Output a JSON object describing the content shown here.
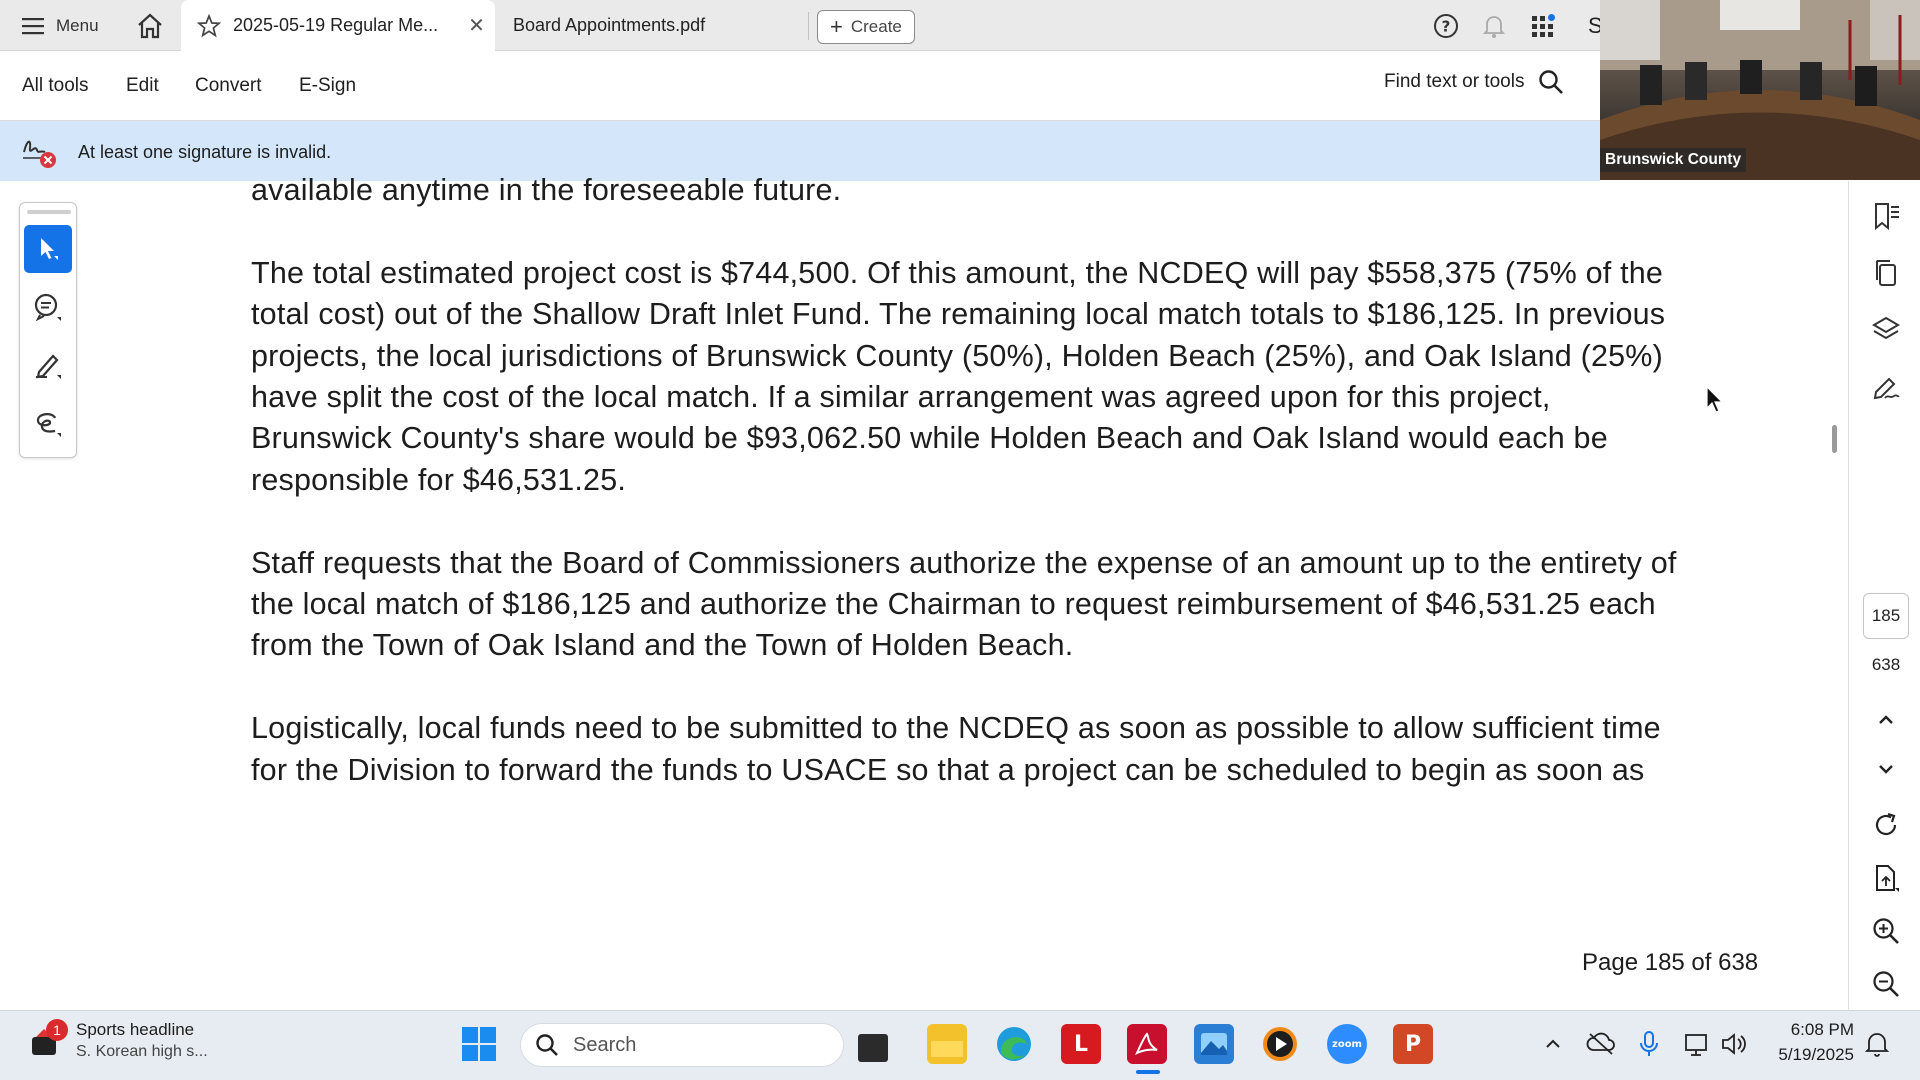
{
  "tabbar": {
    "menu_label": "Menu",
    "tabs": [
      {
        "label": "2025-05-19 Regular Me...",
        "active": true
      },
      {
        "label": "Board Appointments.pdf",
        "active": false
      }
    ],
    "create_label": "Create",
    "profile_initial": "S"
  },
  "toolbar": {
    "menus": [
      "All tools",
      "Edit",
      "Convert",
      "E-Sign"
    ],
    "find_label": "Find text or tools"
  },
  "banner": {
    "message": "At least one signature is invalid."
  },
  "webcam": {
    "caption": "Brunswick County"
  },
  "document": {
    "paragraphs": [
      "available anytime in the foreseeable future.",
      "The total estimated project cost is $744,500. Of this amount, the NCDEQ will pay $558,375 (75% of the total cost) out of the Shallow Draft Inlet Fund. The remaining local match totals to $186,125. In previous projects, the local jurisdictions of Brunswick County (50%), Holden Beach (25%), and Oak Island (25%) have split the cost of the local match. If a similar arrangement was agreed upon for this project, Brunswick County's share would be $93,062.50 while Holden Beach and Oak Island would each be responsible for $46,531.25.",
      "Staff requests that the Board of Commissioners authorize the expense of an amount up to the entirety of the local match of $186,125 and authorize the Chairman to request reimbursement of $46,531.25 each from the Town of Oak Island and the Town of Holden Beach.",
      "Logistically, local funds need to be submitted to the NCDEQ as soon as possible to allow sufficient time for the Division to forward the funds to USACE so that a project can be scheduled to begin as soon as"
    ],
    "page_indicator": "Page 185 of 638"
  },
  "rightrail": {
    "current_page": "185",
    "total_pages": "638"
  },
  "taskbar": {
    "news_badge": "1",
    "news_title": "Sports headline",
    "news_subtitle": "S. Korean high s...",
    "search_placeholder": "Search",
    "time": "6:08 PM",
    "date": "5/19/2025"
  }
}
